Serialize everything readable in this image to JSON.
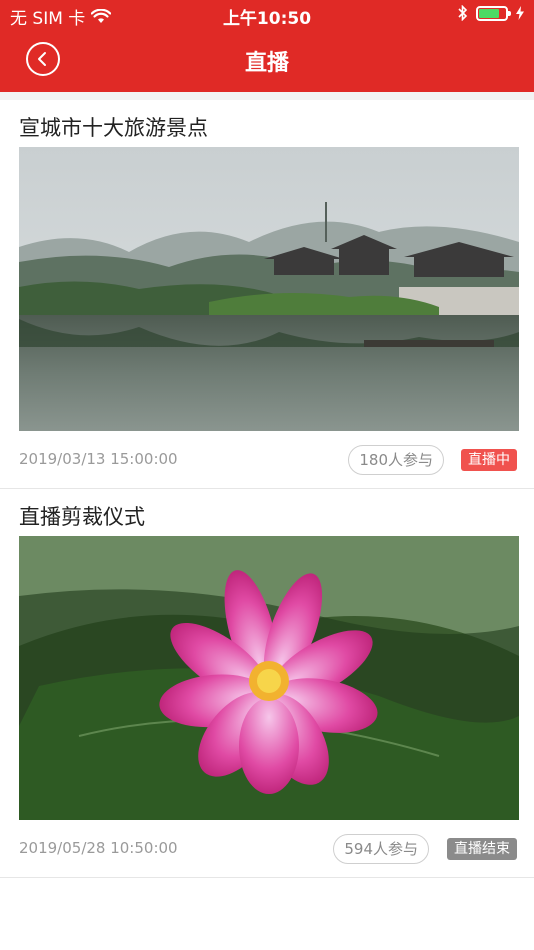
{
  "status_bar": {
    "carrier": "无 SIM 卡",
    "time": "上午10:50",
    "battery_color": "#4cd964"
  },
  "navbar": {
    "title": "直播",
    "back_icon": "chevron-left-icon",
    "background": "#e02a26"
  },
  "items": [
    {
      "title": "宣城市十大旅游景点",
      "date": "2019/03/13 15:00:00",
      "participants": "180人参与",
      "status": "直播中",
      "status_color": "#f0524e"
    },
    {
      "title": "直播剪裁仪式",
      "date": "2019/05/28 10:50:00",
      "participants": "594人参与",
      "status": "直播结束",
      "status_color": "#8b8b8b"
    }
  ]
}
